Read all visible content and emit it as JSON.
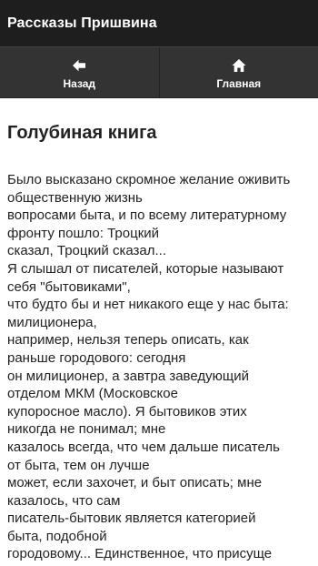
{
  "app": {
    "title": "Рассказы Пришвина"
  },
  "nav": {
    "back_label": "Назад",
    "back_icon": "arrow-left-icon",
    "home_label": "Главная",
    "home_icon": "home-icon"
  },
  "story": {
    "title": "Голубиная книга",
    "lines": [
      "Было высказано скромное желание оживить",
      "общественную жизнь",
      "вопросами быта, и по всему литературному",
      "фронту пошло: Троцкий",
      "сказал, Троцкий сказал...",
      "Я слышал от писателей, которые называют",
      "себя \"бытовиками\",",
      "что будто бы и нет никакого еще у нас быта:",
      "милиционера,",
      "например, нельзя теперь описать, как",
      "раньше городового: сегодня",
      "он милиционер, а завтра заведующий",
      "отделом МКМ (Московское",
      "купоросное масло). Я бытовиков этих",
      "никогда не понимал; мне",
      "казалось всегда, что чем дальше писатель",
      "от быта, тем он лучше",
      "может, если захочет, и быт описать; мне",
      "казалось, что сам",
      "писатель-бытовик является категорией",
      "быта, подобной",
      "городовому... Единственное, что присуще"
    ]
  },
  "colors": {
    "header_bg": "#1e1e1e",
    "nav_bg": "#333333",
    "text": "#222222"
  }
}
